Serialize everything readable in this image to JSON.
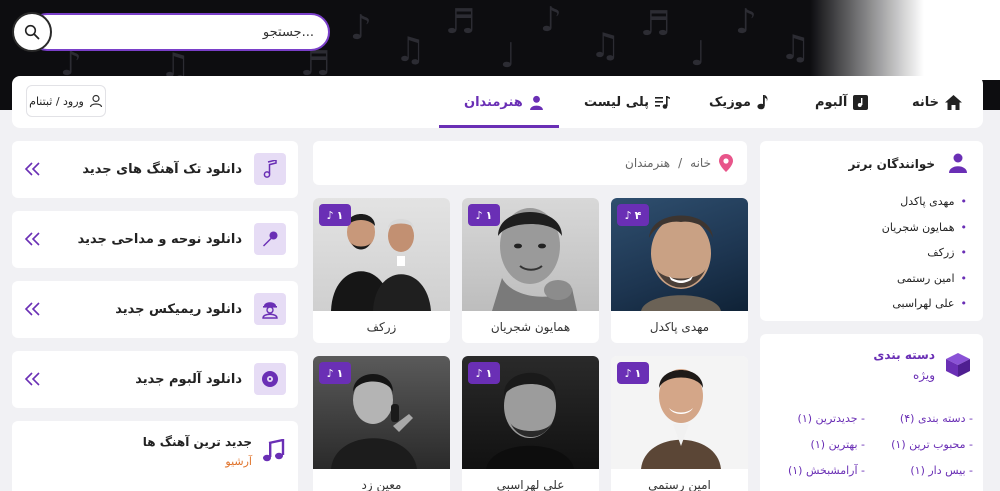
{
  "search": {
    "placeholder": "جستجو..."
  },
  "nav": {
    "items": [
      {
        "label": "خانه",
        "icon": "home-icon"
      },
      {
        "label": "آلبوم",
        "icon": "album-icon"
      },
      {
        "label": "موزیک",
        "icon": "music-note-icon"
      },
      {
        "label": "پلی لیست",
        "icon": "playlist-icon"
      },
      {
        "label": "هنرمندان",
        "icon": "user-icon",
        "active": true
      }
    ],
    "login_label": "ورود / ثبتنام"
  },
  "breadcrumb": {
    "home": "خانه",
    "separator": "/",
    "current": "هنرمندان"
  },
  "downloads": [
    {
      "label": "دانلود تک آهنگ های جدید",
      "icon": "music-note-icon"
    },
    {
      "label": "دانلود نوحه و مداحی جدید",
      "icon": "microphone-icon"
    },
    {
      "label": "دانلود ریمیکس جدید",
      "icon": "dj-icon"
    },
    {
      "label": "دانلود آلبوم جدید",
      "icon": "disc-icon"
    }
  ],
  "newest": {
    "title": "جدید ترین آهنگ ها",
    "subtitle": "آرشیو"
  },
  "artists": [
    {
      "name": "مهدی پاکدل",
      "count": "۴"
    },
    {
      "name": "همایون شجریان",
      "count": "۱"
    },
    {
      "name": "زرکف",
      "count": "۱"
    },
    {
      "name": "امین رستمی",
      "count": "۱"
    },
    {
      "name": "علی لهراسبی",
      "count": "۱"
    },
    {
      "name": "معین زد",
      "count": "۱"
    }
  ],
  "top_singers": {
    "title": "خوانندگان برتر",
    "items": [
      "مهدی پاکدل",
      "همایون شجریان",
      "زرکف",
      "امین رستمی",
      "علی لهراسبی"
    ]
  },
  "special": {
    "title_line1": "دسته بندی",
    "title_line2": "ویژه",
    "categories": [
      {
        "label": "دسته بندی",
        "count": "(۴)"
      },
      {
        "label": "جدیدترین",
        "count": "(۱)"
      },
      {
        "label": "محبوب ترین",
        "count": "(۱)"
      },
      {
        "label": "بهترین",
        "count": "(۱)"
      },
      {
        "label": "بیس دار",
        "count": "(۱)"
      },
      {
        "label": "آرامشبخش",
        "count": "(۱)"
      }
    ]
  },
  "colors": {
    "accent": "#6a2fb5",
    "banner": "#0d0d10",
    "page_bg": "#f1f1f4"
  }
}
